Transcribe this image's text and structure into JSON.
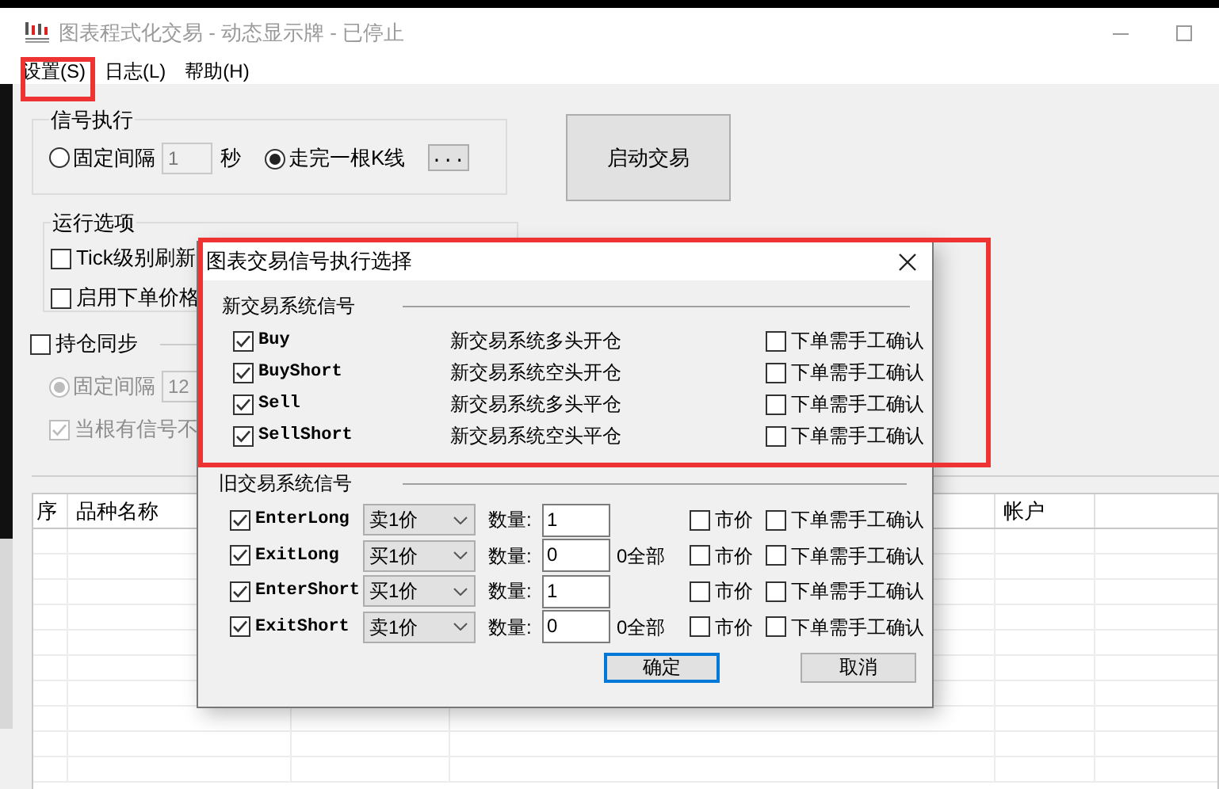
{
  "window": {
    "title": "图表程式化交易 - 动态显示牌 - 已停止"
  },
  "menu": [
    {
      "label": "设置(S)",
      "highlighted": true
    },
    {
      "label": "日志(L)",
      "highlighted": false
    },
    {
      "label": "帮助(H)",
      "highlighted": false
    }
  ],
  "signal_execution": {
    "title": "信号执行",
    "interval": {
      "label": "固定间隔",
      "selected": false,
      "value": "1",
      "unit": "秒"
    },
    "bar": {
      "label": "走完一根K线",
      "selected": true,
      "button": "..."
    }
  },
  "start_button": "启动交易",
  "run_options": {
    "title": "运行选项",
    "items": [
      {
        "label": "Tick级别刷新",
        "checked": false
      },
      {
        "label": "启用下单价格",
        "checked": false
      }
    ]
  },
  "position_sync": {
    "label": "持仓同步",
    "checked": false,
    "interval": {
      "label": "固定间隔",
      "selected": true,
      "value": "12",
      "disabled": true
    },
    "signal_option": {
      "label": "当根有信号不",
      "checked": true,
      "disabled": true
    }
  },
  "table": {
    "columns": [
      {
        "label": "序"
      },
      {
        "label": "品种名称"
      },
      {
        "label": "帐户"
      }
    ]
  },
  "dialog": {
    "title": "图表交易信号执行选择",
    "highlighted": true,
    "new_signals": {
      "title": "新交易系统信号",
      "rows": [
        {
          "name": "Buy",
          "checked": true,
          "description": "新交易系统多头开仓",
          "manual_confirm": {
            "label": "下单需手工确认",
            "checked": false
          }
        },
        {
          "name": "BuyShort",
          "checked": true,
          "description": "新交易系统空头开仓",
          "manual_confirm": {
            "label": "下单需手工确认",
            "checked": false
          }
        },
        {
          "name": "Sell",
          "checked": true,
          "description": "新交易系统多头平仓",
          "manual_confirm": {
            "label": "下单需手工确认",
            "checked": false
          }
        },
        {
          "name": "SellShort",
          "checked": true,
          "description": "新交易系统空头平仓",
          "manual_confirm": {
            "label": "下单需手工确认",
            "checked": false
          }
        }
      ]
    },
    "old_signals": {
      "title": "旧交易系统信号",
      "rows": [
        {
          "name": "EnterLong",
          "checked": true,
          "price": "卖1价",
          "qty_label": "数量:",
          "qty": "1",
          "market": {
            "label": "市价",
            "checked": false
          },
          "manual_confirm": {
            "label": "下单需手工确认",
            "checked": false
          }
        },
        {
          "name": "ExitLong",
          "checked": true,
          "price": "买1价",
          "qty_label": "数量:",
          "qty": "0",
          "note": "0全部",
          "market": {
            "label": "市价",
            "checked": false
          },
          "manual_confirm": {
            "label": "下单需手工确认",
            "checked": false
          }
        },
        {
          "name": "EnterShort",
          "checked": true,
          "price": "买1价",
          "qty_label": "数量:",
          "qty": "1",
          "market": {
            "label": "市价",
            "checked": false
          },
          "manual_confirm": {
            "label": "下单需手工确认",
            "checked": false
          }
        },
        {
          "name": "ExitShort",
          "checked": true,
          "price": "卖1价",
          "qty_label": "数量:",
          "qty": "0",
          "note": "0全部",
          "market": {
            "label": "市价",
            "checked": false
          },
          "manual_confirm": {
            "label": "下单需手工确认",
            "checked": false
          }
        }
      ]
    },
    "buttons": [
      {
        "label": "确定",
        "focused": true
      },
      {
        "label": "取消",
        "focused": false
      }
    ]
  }
}
